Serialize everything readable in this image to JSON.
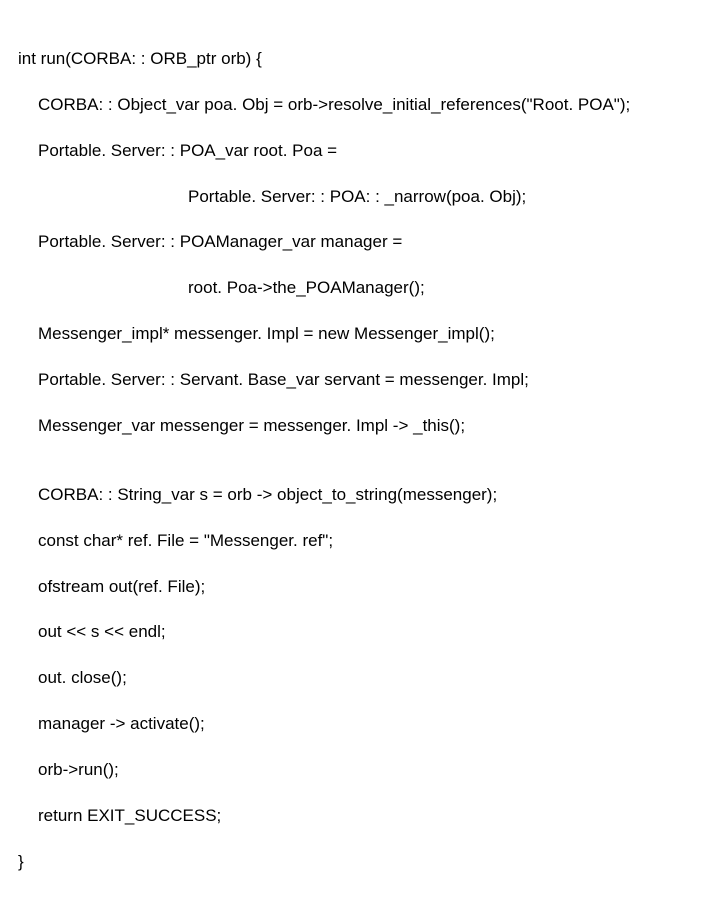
{
  "code": {
    "l0": "int run(CORBA: : ORB_ptr orb) {",
    "l1": "CORBA: : Object_var poa. Obj = orb->resolve_initial_references(\"Root. POA\");",
    "l2": "Portable. Server: : POA_var root. Poa =",
    "l3": "Portable. Server: : POA: : _narrow(poa. Obj);",
    "l4": "Portable. Server: : POAManager_var manager =",
    "l5": "root. Poa->the_POAManager();",
    "l6": "Messenger_impl* messenger. Impl = new Messenger_impl();",
    "l7": "Portable. Server: : Servant. Base_var servant = messenger. Impl;",
    "l8": "Messenger_var messenger = messenger. Impl -> _this();",
    "l9": "CORBA: : String_var s = orb -> object_to_string(messenger);",
    "l10": "const char* ref. File = \"Messenger. ref\";",
    "l11": "ofstream out(ref. File);",
    "l12": "out << s << endl;",
    "l13": "out. close();",
    "l14": "manager -> activate();",
    "l15": "orb->run();",
    "l16": "return EXIT_SUCCESS;",
    "l17": "}"
  }
}
